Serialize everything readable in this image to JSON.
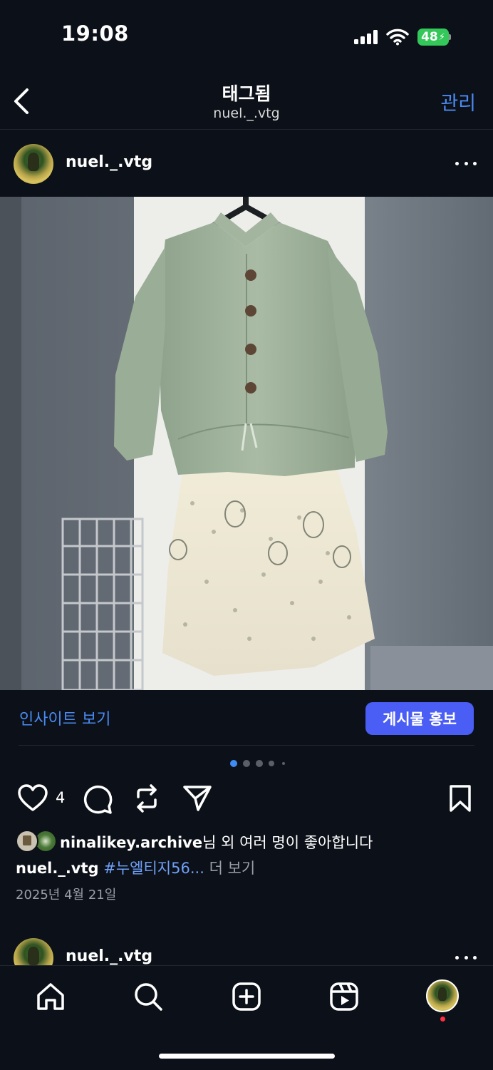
{
  "status_bar": {
    "time": "19:08",
    "battery": "48",
    "icons": [
      "cellular-signal-icon",
      "wifi-icon",
      "battery-charging-icon"
    ]
  },
  "header": {
    "title": "태그됨",
    "subtitle": "nuel._.vtg",
    "manage_label": "관리",
    "back_icon": "chevron-left-icon"
  },
  "post": {
    "username": "nuel._.vtg",
    "image_description_icon": "photo",
    "insights_label": "인사이트 보기",
    "promote_label": "게시물 홍보",
    "carousel": {
      "total": 5,
      "current": 1
    },
    "like_count": "4",
    "liked_by_user": "ninalikey.archive",
    "liked_by_suffix": "님 외 여러 명이 좋아합니다",
    "caption_user": "nuel._.vtg",
    "caption_hashtag": "#누엘티지56...",
    "more_label": "더 보기",
    "date": "2025년 4월 21일"
  },
  "next_post": {
    "username": "nuel._.vtg"
  },
  "bottom_nav": {
    "items": [
      "home-icon",
      "search-icon",
      "create-post-icon",
      "reels-icon",
      "profile-avatar"
    ],
    "notification_color": "#ff3040"
  },
  "colors": {
    "background": "#0c1018",
    "accent": "#4a8bf2",
    "promote_button": "#4a5df5",
    "battery": "#34c759"
  }
}
